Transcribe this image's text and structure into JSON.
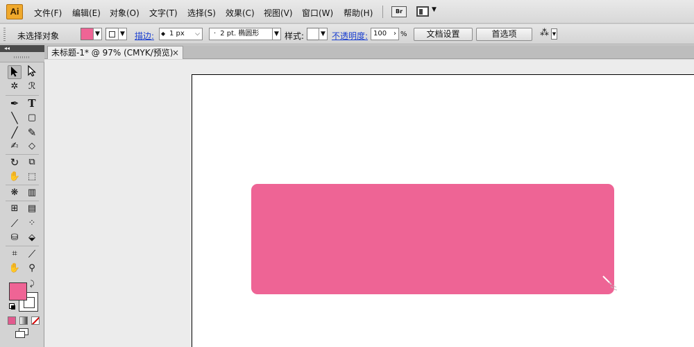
{
  "app": {
    "logo_text": "Ai"
  },
  "menu": {
    "items": [
      {
        "label": "文件(F)"
      },
      {
        "label": "编辑(E)"
      },
      {
        "label": "对象(O)"
      },
      {
        "label": "文字(T)"
      },
      {
        "label": "选择(S)"
      },
      {
        "label": "效果(C)"
      },
      {
        "label": "视图(V)"
      },
      {
        "label": "窗口(W)"
      },
      {
        "label": "帮助(H)"
      }
    ],
    "bridge_label": "Br"
  },
  "control_bar": {
    "selection_status": "未选择对象",
    "fill_color": "#ef6495",
    "stroke_label": "描边:",
    "stroke_weight": "1 px",
    "brush_value": "2 pt. 椭圆形",
    "style_label": "样式:",
    "opacity_label": "不透明度:",
    "opacity_value": "100",
    "opacity_unit": "%",
    "document_setup_label": "文档设置",
    "preferences_label": "首选项"
  },
  "document": {
    "tab_title": "未标题-1* @ 97% (CMYK/预览)",
    "close_glyph": "×"
  },
  "tools_panel": {
    "collapse_glyph": "◂◂",
    "fill_color": "#ef6495",
    "stroke_color": "#ffffff"
  },
  "artwork": {
    "shape": "rounded-rectangle",
    "fill_color": "#ee6495"
  }
}
